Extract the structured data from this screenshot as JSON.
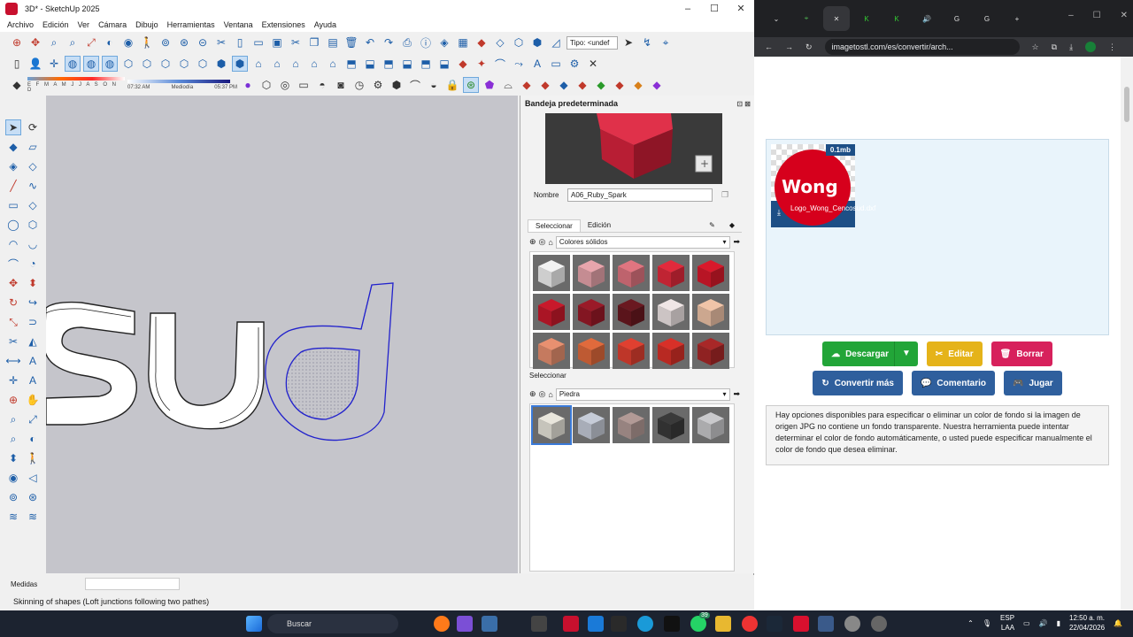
{
  "sketchup": {
    "title": "3D* - SketchUp 2025",
    "menu": [
      "Archivo",
      "Edición",
      "Ver",
      "Cámara",
      "Dibujo",
      "Herramientas",
      "Ventana",
      "Extensiones",
      "Ayuda"
    ],
    "tipo_label": "Tipo: <undef",
    "shadow": {
      "months": "E F M A M J J A S O N D",
      "time_start": "07:32 AM",
      "time_mid": "Mediodía",
      "time_end": "05:37 PM"
    },
    "tray": {
      "title": "Bandeja predeterminada",
      "nombre_label": "Nombre",
      "nombre_value": "A06_Ruby_Spark",
      "tab_select": "Seleccionar",
      "tab_edit": "Edición",
      "library1": "Colores sólidos",
      "section2": "Seleccionar",
      "library2": "Piedra",
      "swatch_colors": [
        "#f2f2f2",
        "#e8a5ac",
        "#e07580",
        "#e22a3c",
        "#d8192b",
        "#c8192b",
        "#9a1a28",
        "#6a1820",
        "#f0e6e6",
        "#f0c4a8",
        "#e89070",
        "#e06a3c",
        "#e04030",
        "#d83028",
        "#a82828"
      ],
      "stone_colors": [
        "#e9e6dc",
        "#c6ccd8",
        "#b29a96",
        "#3a3a3a",
        "#c9c9cc"
      ]
    },
    "status": {
      "medidas": "Medidas",
      "message": "Skinning of shapes (Loft junctions following two pathes)"
    }
  },
  "browser": {
    "url": "imagetostl.com/es/convertir/arch...",
    "file": {
      "size": "0.1mb",
      "name": "Logo_Wong_Cencosud.dxf",
      "logo_text": "Wong"
    },
    "buttons": {
      "download": "Descargar",
      "edit": "Editar",
      "delete": "Borrar",
      "convert_more": "Convertir más",
      "comment": "Comentario",
      "play": "Jugar"
    },
    "description": "Hay opciones disponibles para especificar o eliminar un color de fondo si la imagen de origen JPG no contiene un fondo transparente. Nuestra herramienta puede intentar determinar el color de fondo automáticamente, o usted puede especificar manualmente el color de fondo que desea eliminar."
  },
  "taskbar": {
    "search": "Buscar",
    "lang": "ESP",
    "lang2": "LAA",
    "time": "12:50 a. m.",
    "date": "22/04/2026",
    "badge": "39"
  }
}
